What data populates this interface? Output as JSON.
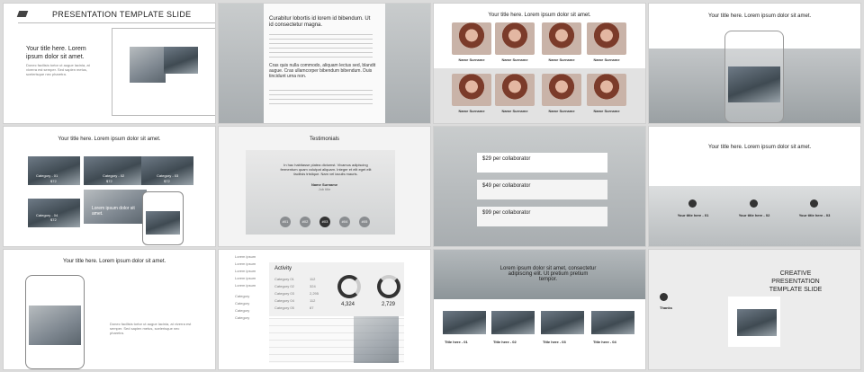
{
  "s1": {
    "title": "PRESENTATION TEMPLATE SLIDE",
    "heading": "Your title here. Lorem ipsum dolor sit amet.",
    "body": "Donec facilisis tortor ut augue lacinia, at viverra est semper. Sed sapien metus, scelerisque nec pharetra."
  },
  "s2": {
    "heading": "Curabitur lobortis id lorem id bibendum. Ut id consectetur magna.",
    "quote": "Cras quis nulla commodo, aliquam lectus sed, blandit augue. Cras ullamcorper bibendum bibendum. Duis tincidunt urna non."
  },
  "s3": {
    "title": "Your title here. Lorem ipsum dolor sit amet.",
    "name": "Name Surname",
    "role": "Job title",
    "faces": 8
  },
  "s4": {
    "title": "Your title here. Lorem ipsum dolor sit amet."
  },
  "s5": {
    "title": "Your title here. Lorem ipsum dolor sit amet.",
    "categories": [
      {
        "label": "Category - 01",
        "price": "$72"
      },
      {
        "label": "Category - 02",
        "price": "$72"
      },
      {
        "label": "Category - 03",
        "price": "$72"
      },
      {
        "label": "Category - 04",
        "price": "$72"
      }
    ],
    "body": "Lorem ipsum dolor sit amet."
  },
  "s6": {
    "title": "Testimonials",
    "quote": "In hac habitasse platea dictumst. Vivamus adipiscing fermentum quam volutpat aliquam. Integer et elit eget elit facilisis tristique. Nam vel iaculis mauris.",
    "name": "Name Surname",
    "role": "Job title",
    "dots": [
      "#01",
      "#02",
      "#03",
      "#04",
      "#05"
    ]
  },
  "s7": {
    "plans": [
      {
        "price": "$29 per collaborator"
      },
      {
        "price": "$49 per collaborator"
      },
      {
        "price": "$99 per collaborator"
      }
    ]
  },
  "s8": {
    "title": "Your title here. Lorem ipsum dolor sit amet.",
    "items": [
      {
        "title": "Your title here - 01"
      },
      {
        "title": "Your title here - 02"
      },
      {
        "title": "Your title here - 03"
      }
    ]
  },
  "s9": {
    "title": "Your title here. Lorem ipsum dolor sit amet.",
    "body": "Donec facilisis tortor ut augue lacinia, at viverra est semper. Sed sapien metus, scelerisque nec pharetra."
  },
  "s10": {
    "menu": [
      "Lorem ipsum",
      "Lorem ipsum",
      "Lorem ipsum",
      "Lorem ipsum",
      "Lorem ipsum",
      "Category",
      "Category",
      "Category",
      "Category"
    ],
    "activity_title": "Activity",
    "rows": [
      {
        "label": "Category 01",
        "value": "112"
      },
      {
        "label": "Category 02",
        "value": "324"
      },
      {
        "label": "Category 03",
        "value": "2,295"
      },
      {
        "label": "Category 04",
        "value": "112"
      },
      {
        "label": "Category 05",
        "value": "87"
      }
    ],
    "gauge1": "4,324",
    "gauge2": "2,729",
    "g1pct": 0.7,
    "g2pct": 0.62
  },
  "s11": {
    "heading": "Lorem ipsum dolor sit amet, consectetur adipiscing elit. Ut pretium pretium tempor.",
    "cards": [
      {
        "title": "Title here - 01"
      },
      {
        "title": "Title here - 02"
      },
      {
        "title": "Title here - 03"
      },
      {
        "title": "Title here - 04"
      }
    ]
  },
  "s12": {
    "heading": "CREATIVE PRESENTATION TEMPLATE SLIDE",
    "label": "Thanks"
  }
}
